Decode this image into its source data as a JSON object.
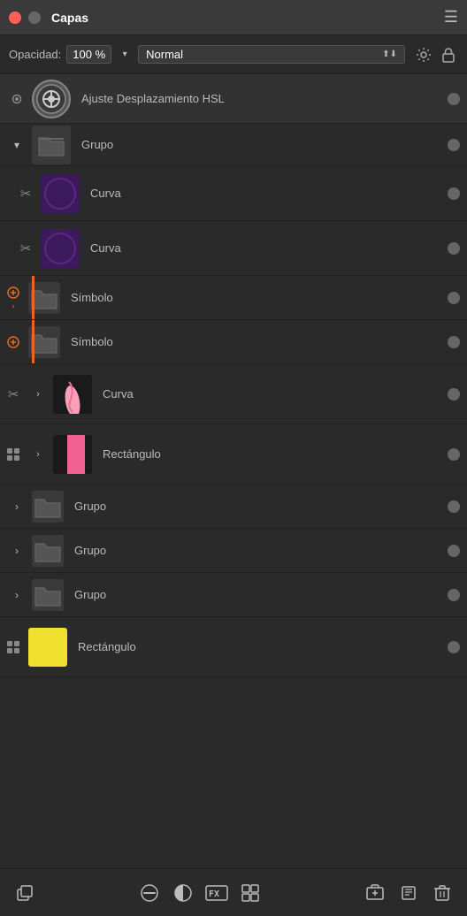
{
  "header": {
    "title": "Capas",
    "menu_icon": "☰"
  },
  "opacity_bar": {
    "label": "Opacidad:",
    "value": "100 %",
    "blend_mode": "Normal",
    "settings_icon": "⚙",
    "lock_icon": "🔒"
  },
  "layers": [
    {
      "id": "adjustment",
      "name": "Ajuste Desplazamiento HSL",
      "type": "adjustment",
      "indent": false,
      "visibility": "eye",
      "has_dot": true
    },
    {
      "id": "grupo1",
      "name": "Grupo",
      "type": "group",
      "indent": true,
      "expand": "chevron-down",
      "has_dot": true
    },
    {
      "id": "curva1",
      "name": "Curva",
      "type": "curve",
      "indent": true,
      "left_icon": "scissors",
      "thumb_color": "purple",
      "has_dot": true
    },
    {
      "id": "curva2",
      "name": "Curva",
      "type": "curve",
      "indent": true,
      "left_icon": "scissors",
      "thumb_color": "purple",
      "has_dot": true
    },
    {
      "id": "simbolo1",
      "name": "Símbolo",
      "type": "group",
      "indent": true,
      "left_icon": "symbol",
      "orange_bar": true,
      "has_dot": true
    },
    {
      "id": "simbolo2",
      "name": "Símbolo",
      "type": "group",
      "indent": true,
      "left_icon": "symbol",
      "orange_bar": true,
      "has_dot": true
    },
    {
      "id": "curva3",
      "name": "Curva",
      "type": "curve",
      "indent": true,
      "left_icon": "scissors",
      "thumb_color": "arm",
      "has_dot": true
    },
    {
      "id": "rectangulo1",
      "name": "Rectángulo",
      "type": "rect",
      "indent": true,
      "left_icon": "grid",
      "thumb_color": "pink",
      "has_dot": true
    },
    {
      "id": "grupo2",
      "name": "Grupo",
      "type": "group",
      "indent": true,
      "has_dot": true
    },
    {
      "id": "grupo3",
      "name": "Grupo",
      "type": "group",
      "indent": true,
      "has_dot": true
    },
    {
      "id": "grupo4",
      "name": "Grupo",
      "type": "group",
      "indent": true,
      "has_dot": true
    },
    {
      "id": "rectangulo2",
      "name": "Rectángulo",
      "type": "rect",
      "indent": false,
      "left_icon": "grid",
      "thumb_color": "yellow",
      "has_dot": true
    }
  ],
  "toolbar": {
    "copy_icon": "copy",
    "circle_icon": "●",
    "circle_half_icon": "◑",
    "fx_icon": "FX",
    "grid_icon": "▦",
    "add_mask_icon": "add-mask",
    "duplicate_icon": "duplicate",
    "delete_icon": "delete"
  }
}
